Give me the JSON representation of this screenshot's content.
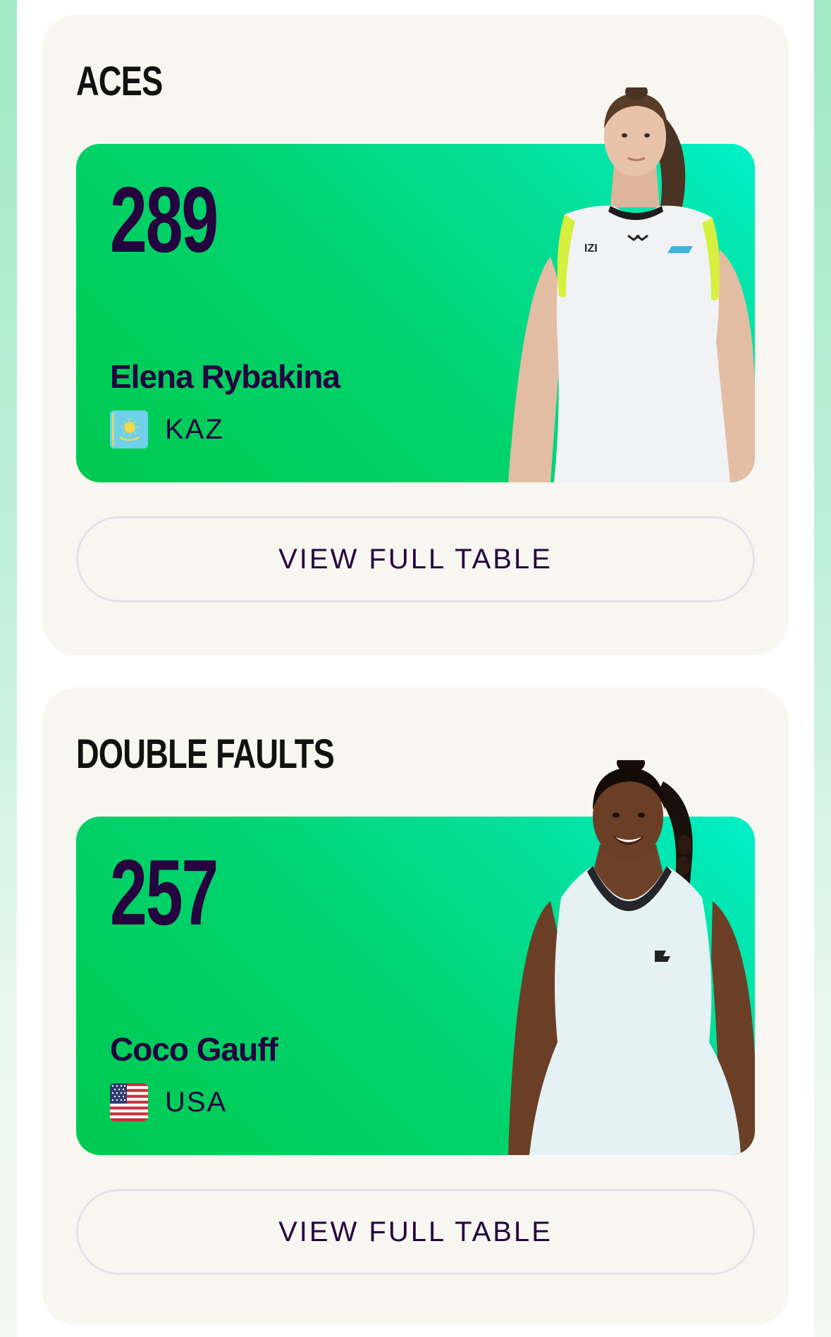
{
  "colors": {
    "accent_green": "#00c94f",
    "accent_teal": "#00f0c8",
    "text_dark": "#24033f",
    "card_bg": "#f7f6f1"
  },
  "stats": [
    {
      "title": "ACES",
      "value": "289",
      "player_name": "Elena Rybakina",
      "country_code": "KAZ",
      "flag_icon": "kazakhstan-flag-icon",
      "button_label": "VIEW FULL TABLE",
      "jersey_text": "IZI"
    },
    {
      "title": "DOUBLE FAULTS",
      "value": "257",
      "player_name": "Coco Gauff",
      "country_code": "USA",
      "flag_icon": "usa-flag-icon",
      "button_label": "VIEW FULL TABLE"
    }
  ]
}
